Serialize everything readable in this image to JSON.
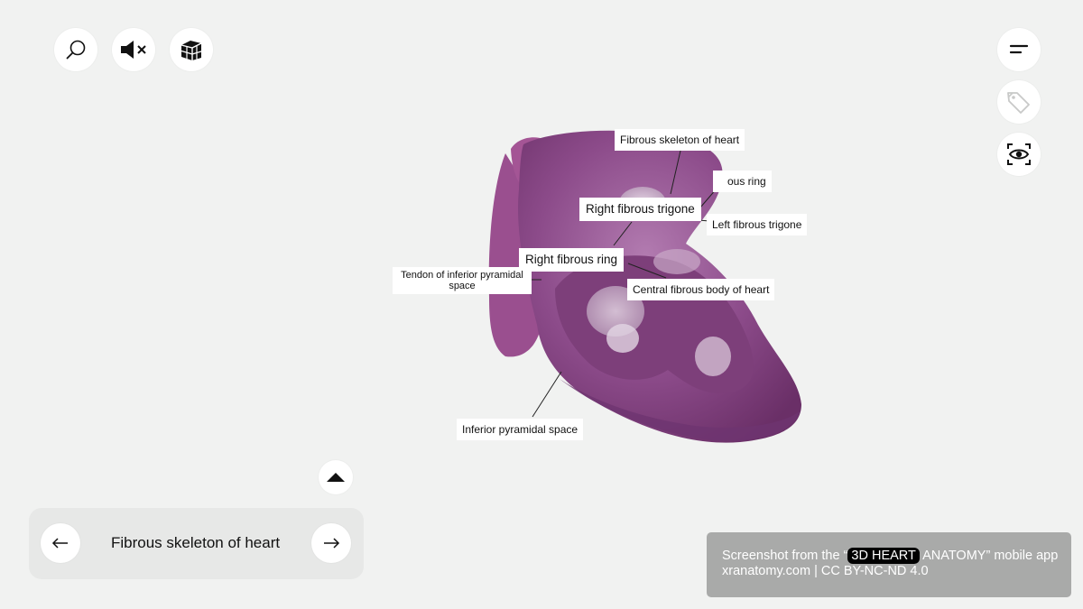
{
  "toolbar_left": {
    "icons": [
      "search-icon",
      "mute-speaker-icon",
      "cube-layers-icon"
    ]
  },
  "toolbar_right": {
    "icons": [
      "menu-icon",
      "tag-icon",
      "eye-scan-icon"
    ]
  },
  "labels": {
    "fibrous_skeleton": "Fibrous skeleton of heart",
    "fibrous_ring_partial": "ous ring",
    "right_fibrous_trigone": "Right fibrous trigone",
    "left_fibrous_trigone": "Left fibrous trigone",
    "right_fibrous_ring": "Right fibrous ring",
    "tendon_inferior": "Tendon of inferior pyramidal space",
    "central_fibrous_body": "Central fibrous body of heart",
    "inferior_pyramidal_space": "Inferior pyramidal space"
  },
  "navigator": {
    "title": "Fibrous skeleton of heart",
    "prev_icon": "arrow-left-icon",
    "next_icon": "arrow-right-icon",
    "expand_icon": "caret-up-icon"
  },
  "attribution": {
    "prefix": "Screenshot from the “",
    "highlight": "3D HEART",
    "suffix": " ANATOMY” mobile app",
    "line2": "xranatomy.com | CC BY-NC-ND 4.0"
  },
  "colors": {
    "background": "#f1f2f1",
    "heart_main": "#8e4a8c",
    "heart_dark": "#6b2f66",
    "heart_light": "#b97fb4",
    "valve": "#d9cfe0"
  }
}
